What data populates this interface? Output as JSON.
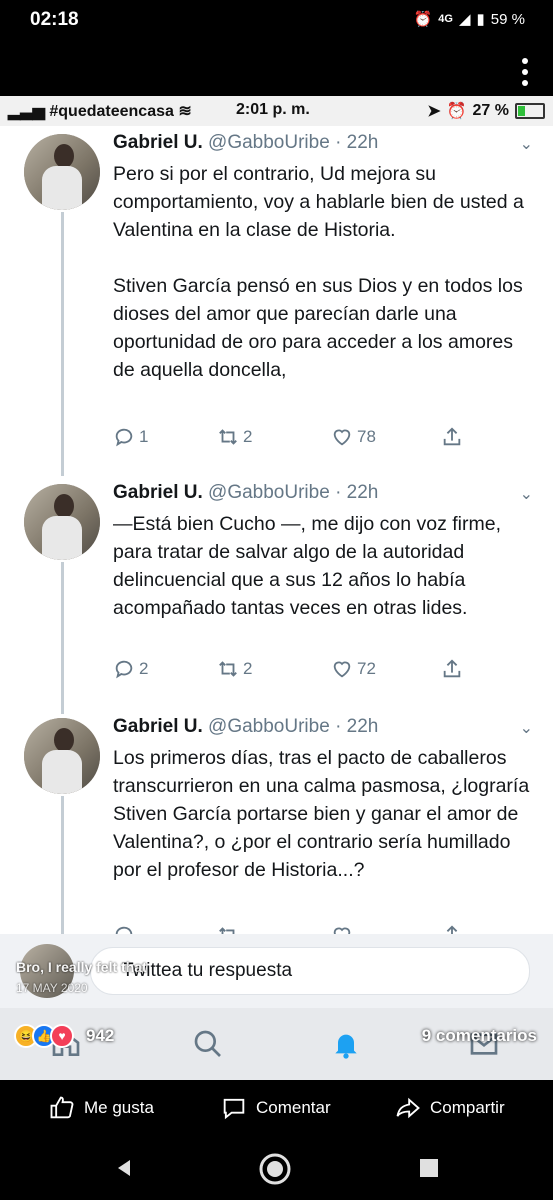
{
  "device_status": {
    "time": "02:18",
    "network": "4G",
    "battery": "59 %"
  },
  "shot_status": {
    "carrier": "#quedateencasa",
    "time": "2:01 p. m.",
    "battery": "27 %"
  },
  "tweets": [
    {
      "name": "Gabriel U.",
      "handle": "@GabboUribe",
      "age": "· 22h",
      "text": "Pero si por el contrario, Ud mejora su comportamiento, voy a hablarle bien de usted a Valentina en la clase de Historia.\n\nStiven García pensó en sus Dios y en todos los dioses del amor que parecían darle una oportunidad de oro para acceder a los amores de aquella doncella,",
      "replies": "1",
      "retweets": "2",
      "likes": "78"
    },
    {
      "name": "Gabriel U.",
      "handle": "@GabboUribe",
      "age": "· 22h",
      "text": "—Está bien Cucho —,  me dijo con voz firme, para tratar de salvar algo de la autoridad delincuencial que a sus 12 años lo había acompañado tantas veces en otras lides.",
      "replies": "2",
      "retweets": "2",
      "likes": "72"
    },
    {
      "name": "Gabriel U.",
      "handle": "@GabboUribe",
      "age": "· 22h",
      "text": "Los primeros días, tras el pacto de caballeros transcurrieron en una calma pasmosa, ¿lograría Stiven García portarse bien y ganar el amor de Valentina?, o ¿por el contrario sería humillado por el profesor de Historia...?",
      "replies": "",
      "retweets": "",
      "likes": ""
    }
  ],
  "reply_placeholder": "Twittea tu respuesta",
  "overlay": {
    "caption": "Bro, I really felt that",
    "date": "17 MAY 2020"
  },
  "post": {
    "reactions_count": "942",
    "comments_count": "9 comentarios"
  },
  "fb_actions": {
    "like": "Me gusta",
    "comment": "Comentar",
    "share": "Compartir"
  },
  "colors": {
    "twitter_gray": "#657786",
    "text": "#14171a",
    "notification_blue": "#1da1f2"
  }
}
